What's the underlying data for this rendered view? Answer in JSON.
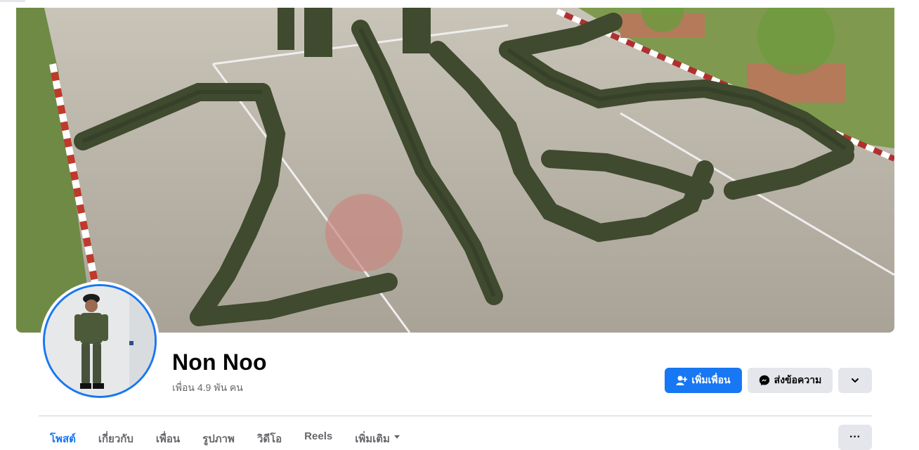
{
  "profile": {
    "name": "Non Noo",
    "friends_text": "เพื่อน 4.9 พัน คน"
  },
  "actions": {
    "add_friend_label": "เพิ่มเพื่อน",
    "message_label": "ส่งข้อความ",
    "more_icon": "chevron-down-icon"
  },
  "tabs": [
    {
      "label": "โพสต์",
      "active": true
    },
    {
      "label": "เกี่ยวกับ",
      "active": false
    },
    {
      "label": "เพื่อน",
      "active": false
    },
    {
      "label": "รูปภาพ",
      "active": false
    },
    {
      "label": "วิดีโอ",
      "active": false
    },
    {
      "label": "Reels",
      "active": false
    },
    {
      "label": "เพิ่มเติม",
      "active": false,
      "has_caret": true
    }
  ],
  "tab_overflow_label": "···",
  "colors": {
    "accent": "#1877f2",
    "secondary_button": "#e4e6eb",
    "muted_text": "#65676b",
    "primary_text": "#050505"
  }
}
